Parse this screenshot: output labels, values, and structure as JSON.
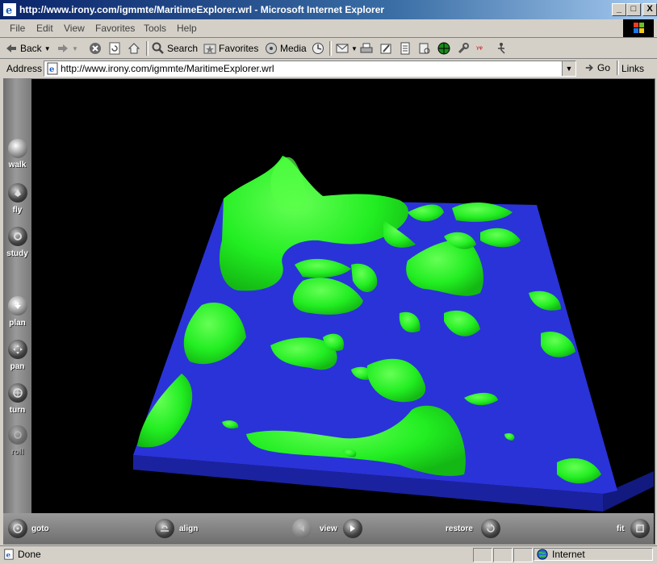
{
  "window": {
    "title": "http://www.irony.com/igmmte/MaritimeExplorer.wrl - Microsoft Internet Explorer",
    "minimize_label": "_",
    "maximize_label": "□",
    "close_label": "X"
  },
  "menu": [
    "File",
    "Edit",
    "View",
    "Favorites",
    "Tools",
    "Help"
  ],
  "toolbar": {
    "back_label": "Back",
    "search_label": "Search",
    "favorites_label": "Favorites",
    "media_label": "Media"
  },
  "address": {
    "label": "Address",
    "url": "http://www.irony.com/igmmte/MaritimeExplorer.wrl",
    "go_label": "Go",
    "links_label": "Links"
  },
  "viewer": {
    "nav_modes": [
      {
        "label": "walk"
      },
      {
        "label": "fly"
      },
      {
        "label": "study"
      },
      {
        "label": "plan"
      },
      {
        "label": "pan"
      },
      {
        "label": "turn"
      },
      {
        "label": "roll"
      }
    ],
    "bottom_controls": {
      "goto": "goto",
      "align": "align",
      "view": "view",
      "restore": "restore",
      "fit": "fit"
    },
    "colors": {
      "water": "#2a33d8",
      "land": "#22ee22",
      "base": "#1a22a0",
      "background": "#000000"
    }
  },
  "status": {
    "text": "Done",
    "zone": "Internet"
  }
}
